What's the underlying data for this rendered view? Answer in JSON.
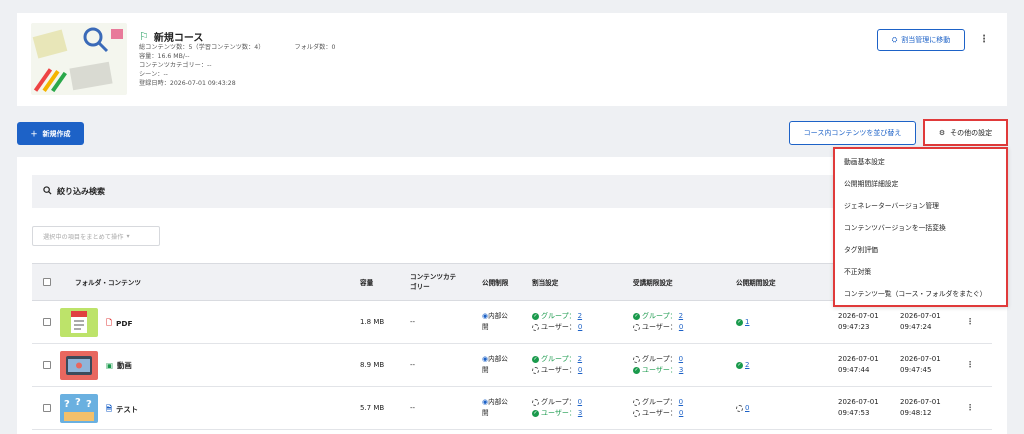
{
  "course": {
    "title": "新規コース",
    "content_count": "総コンテンツ数：5（学習コンテンツ数：4）",
    "folder_count": "フォルダ数：0",
    "capacity": "容量：16.6 MB/--",
    "category": "コンテンツカテゴリー：--",
    "scene": "シーン：--",
    "registered": "登録日時：2026-07-01 09:43:28",
    "move_button": "割当管理に移動"
  },
  "toolbar": {
    "new_button": "新規作成",
    "reorder_button": "コース内コンテンツを並び替え",
    "other_settings_button": "その他の設定"
  },
  "filter": {
    "label": "絞り込み検索",
    "bulk_action": "選択中の項目をまとめて操作"
  },
  "table": {
    "headers": {
      "folder_content": "フォルダ・コンテンツ",
      "size": "容量",
      "category_line1": "コンテンツカテ",
      "category_line2": "ゴリー",
      "publish_limit": "公開制限",
      "assignment": "割当設定",
      "attendance_period": "受講期限設定",
      "publish_period": "公開期間設定"
    },
    "rows": [
      {
        "name": "PDF",
        "size": "1.8 MB",
        "category": "--",
        "pub1": "内部公",
        "pub2": "開",
        "assign_group": "グループ：",
        "assign_group_n": "2",
        "assign_user": "ユーザー：",
        "assign_user_n": "0",
        "att_group": "グループ：",
        "att_group_n": "2",
        "att_user": "ユーザー：",
        "att_user_n": "0",
        "period_n": "1",
        "d1a": "2026-07-01",
        "d1b": "09:47:23",
        "d2a": "2026-07-01",
        "d2b": "09:47:24"
      },
      {
        "name": "動画",
        "size": "8.9 MB",
        "category": "--",
        "pub1": "内部公",
        "pub2": "開",
        "assign_group": "グループ：",
        "assign_group_n": "2",
        "assign_user": "ユーザー：",
        "assign_user_n": "0",
        "att_group": "グループ：",
        "att_group_n": "0",
        "att_user": "ユーザー：",
        "att_user_n": "3",
        "period_n": "2",
        "d1a": "2026-07-01",
        "d1b": "09:47:44",
        "d2a": "2026-07-01",
        "d2b": "09:47:45"
      },
      {
        "name": "テスト",
        "size": "5.7 MB",
        "category": "--",
        "pub1": "内部公",
        "pub2": "開",
        "assign_group": "グループ：",
        "assign_group_n": "0",
        "assign_user": "ユーザー：",
        "assign_user_n": "3",
        "att_group": "グループ：",
        "att_group_n": "0",
        "att_user": "ユーザー：",
        "att_user_n": "0",
        "period_n": "0",
        "d1a": "2026-07-01",
        "d1b": "09:47:53",
        "d2a": "2026-07-01",
        "d2b": "09:48:12"
      }
    ]
  },
  "dropdown": {
    "items": [
      "動画基本設定",
      "公開期間詳細設定",
      "ジェネレーターバージョン管理",
      "コンテンツバージョンを一括変換",
      "タグ別評価",
      "不正対策",
      "コンテンツ一覧（コース・フォルダをまたぐ）"
    ]
  },
  "colors": {
    "primary": "#1d62c7",
    "success": "#1a9a4c",
    "highlight": "#e03a3a"
  }
}
